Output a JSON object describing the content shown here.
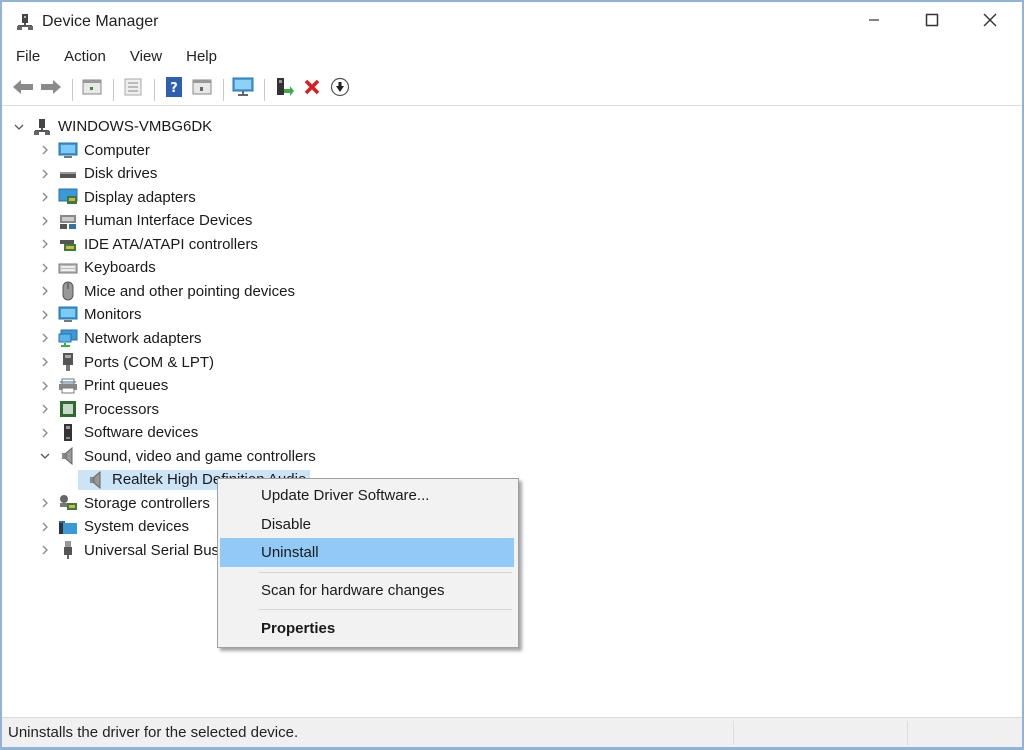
{
  "window": {
    "title": "Device Manager",
    "controls": {
      "minimize": "minimize",
      "maximize": "maximize",
      "close": "close"
    }
  },
  "menubar": {
    "items": [
      {
        "label": "File"
      },
      {
        "label": "Action"
      },
      {
        "label": "View"
      },
      {
        "label": "Help"
      }
    ]
  },
  "toolbar": {
    "buttons": [
      {
        "name": "back",
        "icon": "back-arrow-icon"
      },
      {
        "name": "forward",
        "icon": "forward-arrow-icon"
      },
      {
        "name": "show-hide-console-tree",
        "icon": "console-tree-icon"
      },
      {
        "name": "properties",
        "icon": "properties-icon"
      },
      {
        "name": "help",
        "icon": "help-icon"
      },
      {
        "name": "show-action-pane",
        "icon": "action-pane-icon"
      },
      {
        "name": "scan-hardware",
        "icon": "monitor-scan-icon"
      },
      {
        "name": "update-driver",
        "icon": "update-driver-icon"
      },
      {
        "name": "uninstall",
        "icon": "red-x-icon"
      },
      {
        "name": "disable-device",
        "icon": "down-arrow-circle-icon"
      }
    ]
  },
  "tree": {
    "root": {
      "label": "WINDOWS-VMBG6DK",
      "expanded": true,
      "icon": "computer-network-icon"
    },
    "categories": [
      {
        "label": "Computer",
        "icon": "monitor-icon",
        "expanded": false
      },
      {
        "label": "Disk drives",
        "icon": "disk-drive-icon",
        "expanded": false
      },
      {
        "label": "Display adapters",
        "icon": "display-adapter-icon",
        "expanded": false
      },
      {
        "label": "Human Interface Devices",
        "icon": "hid-icon",
        "expanded": false
      },
      {
        "label": "IDE ATA/ATAPI controllers",
        "icon": "ide-controller-icon",
        "expanded": false
      },
      {
        "label": "Keyboards",
        "icon": "keyboard-icon",
        "expanded": false
      },
      {
        "label": "Mice and other pointing devices",
        "icon": "mouse-icon",
        "expanded": false
      },
      {
        "label": "Monitors",
        "icon": "monitor-icon",
        "expanded": false
      },
      {
        "label": "Network adapters",
        "icon": "network-adapter-icon",
        "expanded": false
      },
      {
        "label": "Ports (COM & LPT)",
        "icon": "port-icon",
        "expanded": false
      },
      {
        "label": "Print queues",
        "icon": "printer-icon",
        "expanded": false
      },
      {
        "label": "Processors",
        "icon": "processor-icon",
        "expanded": false
      },
      {
        "label": "Software devices",
        "icon": "software-device-icon",
        "expanded": false
      },
      {
        "label": "Sound, video and game controllers",
        "icon": "speaker-icon",
        "expanded": true,
        "children": [
          {
            "label": "Realtek High Definition Audio",
            "icon": "speaker-icon",
            "selected": true
          }
        ]
      },
      {
        "label": "Storage controllers",
        "icon": "storage-controller-icon",
        "expanded": false
      },
      {
        "label": "System devices",
        "icon": "system-folder-icon",
        "expanded": false
      },
      {
        "label": "Universal Serial Bus controllers",
        "icon": "usb-icon",
        "expanded": false
      }
    ]
  },
  "context_menu": {
    "items": [
      {
        "label": "Update Driver Software...",
        "highlighted": false,
        "bold": false
      },
      {
        "label": "Disable",
        "highlighted": false,
        "bold": false
      },
      {
        "label": "Uninstall",
        "highlighted": true,
        "bold": false
      },
      {
        "separator": true
      },
      {
        "label": "Scan for hardware changes",
        "highlighted": false,
        "bold": false
      },
      {
        "separator": true
      },
      {
        "label": "Properties",
        "highlighted": false,
        "bold": true
      }
    ]
  },
  "statusbar": {
    "text": "Uninstalls the driver for the selected device."
  },
  "colors": {
    "window_border": "#8fb4d6",
    "selection": "#cce4f7",
    "menu_highlight": "#91c9f7",
    "menu_bg": "#f2f2f2",
    "status_bg": "#f0f0f0"
  }
}
